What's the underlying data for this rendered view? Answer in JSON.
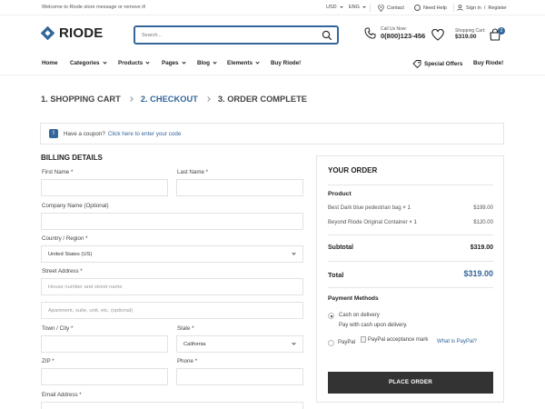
{
  "topbar": {
    "welcome": "Welcome to Riode store message or remove it!",
    "currency": "USD",
    "language": "ENG",
    "contact": "Contact",
    "need_help": "Need Help",
    "sign_in": "Sign in",
    "divider": "/",
    "register": "Register"
  },
  "header": {
    "logo_text": "RIODE",
    "search_placeholder": "Search...",
    "call_label": "Call Us Now:",
    "call_number": "0(800)123-456",
    "cart_label": "Shopping Cart:",
    "cart_total": "$319.00",
    "cart_count": "2"
  },
  "nav": {
    "items": [
      "Home",
      "Categories",
      "Products",
      "Pages",
      "Blog",
      "Elements",
      "Buy Riode!"
    ],
    "special_offers": "Special Offers",
    "buy_right": "Buy Riode!"
  },
  "steps": [
    "1. SHOPPING CART",
    "2. CHECKOUT",
    "3. ORDER COMPLETE"
  ],
  "coupon": {
    "icon": "!",
    "text": "Have a coupon?",
    "link": "Click here to enter your code"
  },
  "billing": {
    "title": "BILLING DETAILS",
    "first_name": "First Name *",
    "last_name": "Last Name *",
    "company": "Company Name (Optional)",
    "country_label": "Country / Region *",
    "country_value": "United States (US)",
    "street_label": "Street Address *",
    "street_ph1": "House number and street name",
    "street_ph2": "Apartment, suite, unit, etc. (optional)",
    "town_label": "Town / City *",
    "state_label": "State *",
    "state_value": "California",
    "zip_label": "ZIP *",
    "phone_label": "Phone *",
    "email_label": "Email Address *"
  },
  "order": {
    "title": "YOUR ORDER",
    "product_header": "Product",
    "items": [
      {
        "name": "Best Dark blue pedestrian bag",
        "qty": "× 1",
        "price": "$199.00"
      },
      {
        "name": "Beyond Riode Original Container",
        "qty": "× 1",
        "price": "$120.00"
      }
    ],
    "subtotal_label": "Subtotal",
    "subtotal_value": "$319.00",
    "total_label": "Total",
    "total_value": "$319.00",
    "payment_title": "Payment Methods",
    "cod_label": "Cash on delivery",
    "cod_desc": "Pay with cash upon delivery.",
    "paypal_label": "PayPal",
    "paypal_img_alt": "PayPal acceptance mark",
    "paypal_link": "What is PayPal?",
    "place_order": "PLACE ORDER"
  },
  "colors": {
    "accent": "#336699",
    "dark_button": "#333333"
  }
}
